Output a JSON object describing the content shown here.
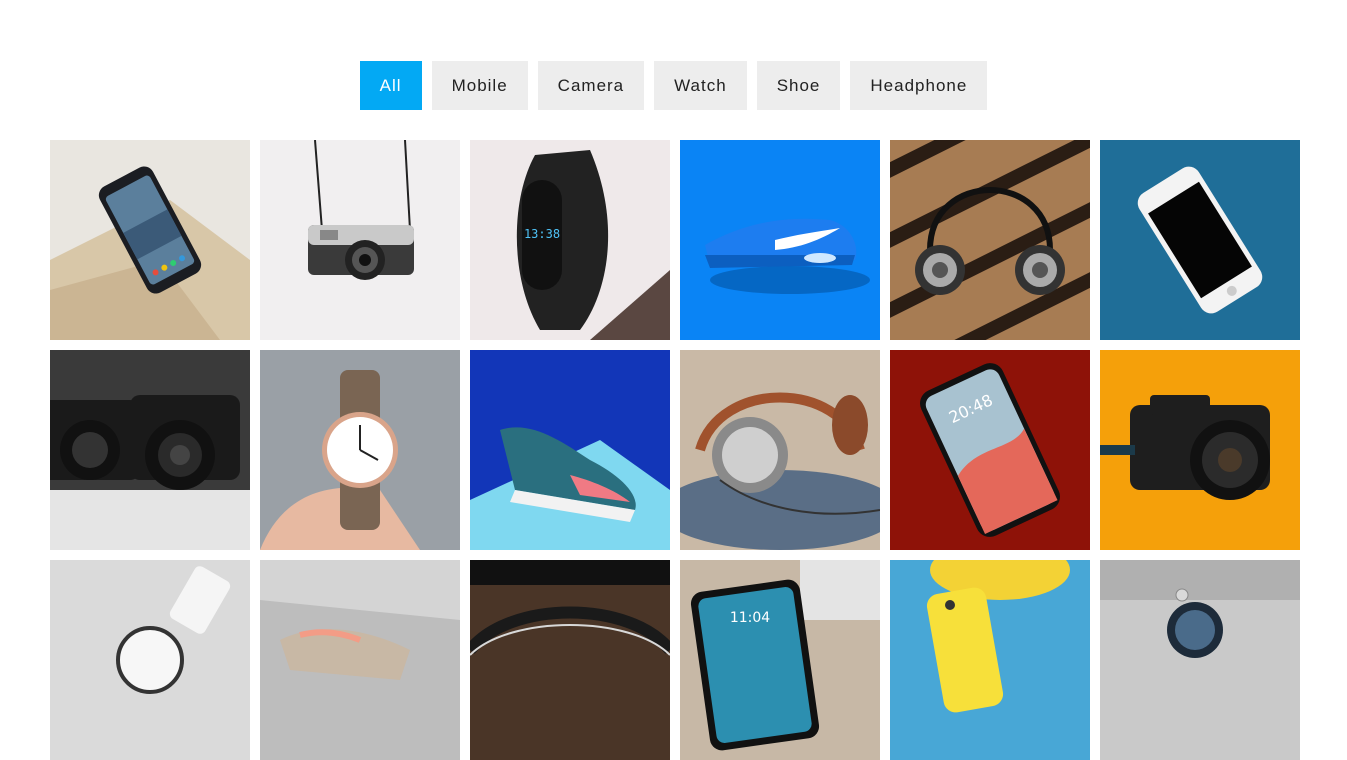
{
  "filters": {
    "active": "All",
    "items": [
      "All",
      "Mobile",
      "Camera",
      "Watch",
      "Shoe",
      "Headphone"
    ]
  },
  "colors": {
    "accent": "#03a9f4",
    "button_bg": "#ededed"
  },
  "gallery": {
    "items": [
      {
        "category": "Mobile",
        "icon": "smartphone-icon",
        "bg": "#e8e4dc"
      },
      {
        "category": "Camera",
        "icon": "camera-icon",
        "bg": "#f1eff0"
      },
      {
        "category": "Watch",
        "icon": "fitness-band-icon",
        "bg": "#ece6e6"
      },
      {
        "category": "Shoe",
        "icon": "sneaker-icon",
        "bg": "#0a84f5"
      },
      {
        "category": "Headphone",
        "icon": "headphones-icon",
        "bg": "#a87b52"
      },
      {
        "category": "Mobile",
        "icon": "smartphone-icon",
        "bg": "#1f6e98"
      },
      {
        "category": "Camera",
        "icon": "camera-icon",
        "bg": "#3a3a3a"
      },
      {
        "category": "Watch",
        "icon": "wristwatch-icon",
        "bg": "#9aa0a6"
      },
      {
        "category": "Shoe",
        "icon": "sneaker-icon",
        "bg": "#1236b8"
      },
      {
        "category": "Headphone",
        "icon": "headphones-icon",
        "bg": "#c9b9a6"
      },
      {
        "category": "Mobile",
        "icon": "smartphone-icon",
        "bg": "#8e1208"
      },
      {
        "category": "Camera",
        "icon": "camera-icon",
        "bg": "#f5a00a"
      },
      {
        "category": "Watch",
        "icon": "wristwatch-icon",
        "bg": "#dadada"
      },
      {
        "category": "Shoe",
        "icon": "sneaker-icon",
        "bg": "#bdbdbd"
      },
      {
        "category": "Headphone",
        "icon": "headphones-icon",
        "bg": "#4a3527"
      },
      {
        "category": "Mobile",
        "icon": "smartphone-icon",
        "bg": "#c7b8a6"
      },
      {
        "category": "Mobile",
        "icon": "smartphone-icon",
        "bg": "#48a7d6"
      },
      {
        "category": "Watch",
        "icon": "wristwatch-icon",
        "bg": "#c9c9c9"
      }
    ]
  }
}
